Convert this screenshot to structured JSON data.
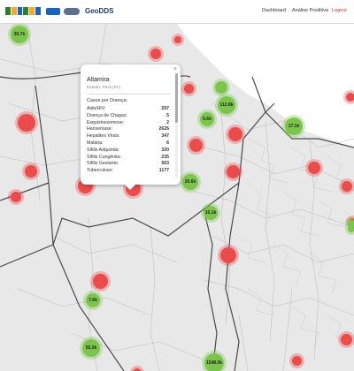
{
  "navbar": {
    "brand": "GeoDDS",
    "links": [
      {
        "label": "Dashboard"
      },
      {
        "label": "Análise Preditiva"
      },
      {
        "label": "Logout"
      }
    ]
  },
  "colors": {
    "high_cluster": "#ea4b4b",
    "low_cluster": "#7bc64a",
    "logout": "#d0342c"
  },
  "clusters": [
    {
      "label": "20.7k",
      "color": "green"
    },
    {
      "label": "",
      "color": "red"
    },
    {
      "label": "",
      "color": "red"
    },
    {
      "label": "",
      "color": "red"
    },
    {
      "label": "",
      "color": "red"
    },
    {
      "label": "",
      "color": "red"
    },
    {
      "label": "",
      "color": "red"
    },
    {
      "label": "",
      "color": "red"
    },
    {
      "label": "",
      "color": "green"
    },
    {
      "label": "112.8k",
      "color": "green"
    },
    {
      "label": "6.6k",
      "color": "green"
    },
    {
      "label": "",
      "color": "red"
    },
    {
      "label": "",
      "color": "red"
    },
    {
      "label": "17.1k",
      "color": "green"
    },
    {
      "label": "",
      "color": "red"
    },
    {
      "label": "",
      "color": "red"
    },
    {
      "label": "",
      "color": "red"
    },
    {
      "label": "20.6k",
      "color": "green"
    },
    {
      "label": "",
      "color": "red"
    },
    {
      "label": "",
      "color": "red"
    },
    {
      "label": "",
      "color": "red"
    },
    {
      "label": "10.1k",
      "color": "green"
    },
    {
      "label": "",
      "color": "red"
    },
    {
      "label": "",
      "color": "red"
    },
    {
      "label": "7.6k",
      "color": "green"
    },
    {
      "label": "",
      "color": "red"
    },
    {
      "label": "55.3k",
      "color": "green"
    },
    {
      "label": "",
      "color": "green"
    },
    {
      "label": "1548.0k",
      "color": "green"
    },
    {
      "label": "",
      "color": "red"
    },
    {
      "label": "",
      "color": "red"
    }
  ],
  "popup": {
    "city": "Altamira",
    "state": "Estado: Pará (PA)",
    "heading": "Casos por Doença:",
    "rows": [
      {
        "label": "Aids/HIV:",
        "value": "297"
      },
      {
        "label": "Doença de Chagas:",
        "value": "5"
      },
      {
        "label": "Esquistossomose:",
        "value": "2"
      },
      {
        "label": "Hanseníase:",
        "value": "2626"
      },
      {
        "label": "Hepatites Virais:",
        "value": "347"
      },
      {
        "label": "Malária:",
        "value": "6"
      },
      {
        "label": "Sífilis Adquirida:",
        "value": "320"
      },
      {
        "label": "Sífilis Congênita:",
        "value": "235"
      },
      {
        "label": "Sífilis Gestante:",
        "value": "563"
      },
      {
        "label": "Tuberculose:",
        "value": "1177"
      }
    ]
  }
}
